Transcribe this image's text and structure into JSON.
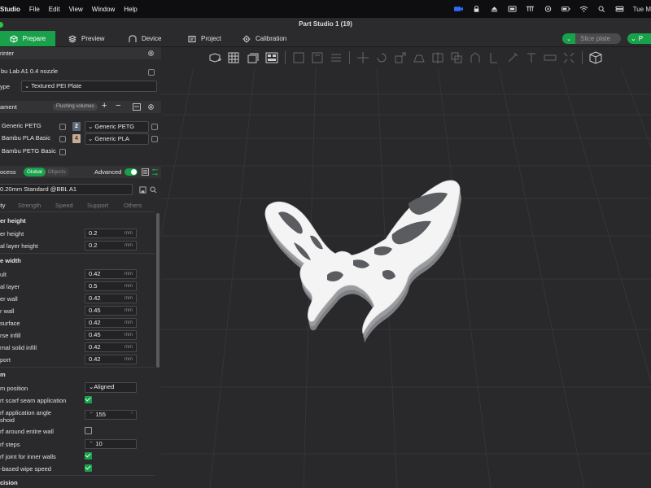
{
  "menubar": {
    "app": "Studio",
    "items": [
      "File",
      "Edit",
      "View",
      "Window",
      "Help"
    ],
    "clock": "Tue M"
  },
  "window": {
    "title": "Part Studio 1 (19)"
  },
  "tabs": [
    {
      "label": "Prepare",
      "icon": "cube-icon"
    },
    {
      "label": "Preview",
      "icon": "layers-icon"
    },
    {
      "label": "Device",
      "icon": "device-icon"
    },
    {
      "label": "Project",
      "icon": "project-icon"
    },
    {
      "label": "Calibration",
      "icon": "calibration-icon"
    }
  ],
  "actions": {
    "slice": "Slice plate",
    "print": "P"
  },
  "printer": {
    "header": "rinter",
    "name": "bu Lab A1 0.4 nozzle",
    "plate_label": "ype",
    "plate_value": "Textured PEI Plate"
  },
  "filament": {
    "header": "ament",
    "flushing": "Flushing volumes",
    "rows": [
      {
        "name": "Generic PETG",
        "slot": "2",
        "slot_color": "#5c6878",
        "mapped": "Generic PETG"
      },
      {
        "name": "Bambu PLA Basic",
        "slot": "4",
        "slot_color": "#c9a991",
        "mapped": "Generic PLA"
      },
      {
        "name": "Bambu PETG Basic",
        "slot": "",
        "slot_color": "",
        "mapped": ""
      }
    ]
  },
  "process": {
    "header": "ocess",
    "scope_on": "Global",
    "scope_off": "Objects",
    "advanced": "Advanced",
    "preset": "0.20mm Standard @BBL A1",
    "tabs": [
      "ity",
      "Strength",
      "Speed",
      "Support",
      "Others"
    ]
  },
  "settings": {
    "layer_height": {
      "title": "er height",
      "rows": [
        {
          "label": "er height",
          "value": "0.2",
          "unit": "mm"
        },
        {
          "label": "al layer height",
          "value": "0.2",
          "unit": "mm"
        }
      ]
    },
    "line_width": {
      "title": "e width",
      "rows": [
        {
          "label": "ult",
          "value": "0.42",
          "unit": "mm"
        },
        {
          "label": "al layer",
          "value": "0.5",
          "unit": "mm"
        },
        {
          "label": "er wall",
          "value": "0.42",
          "unit": "mm"
        },
        {
          "label": "r wall",
          "value": "0.45",
          "unit": "mm"
        },
        {
          "label": "surface",
          "value": "0.42",
          "unit": "mm"
        },
        {
          "label": "rse infill",
          "value": "0.45",
          "unit": "mm"
        },
        {
          "label": "rnal solid infill",
          "value": "0.42",
          "unit": "mm"
        },
        {
          "label": "port",
          "value": "0.42",
          "unit": "mm"
        }
      ]
    },
    "seam": {
      "title": "m",
      "position_label": "m position",
      "position_value": "Aligned",
      "smart_scarf": "rt scarf seam application",
      "angle_label_1": "rf application angle",
      "angle_label_2": "shoid",
      "angle_value": "155",
      "around_wall": "rf around entire wall",
      "steps_label": "rf steps",
      "steps_value": "10",
      "inner_walls": "rf joint for inner walls",
      "wipe_speed": "-based wipe speed"
    },
    "precision": {
      "title": "cision"
    }
  }
}
